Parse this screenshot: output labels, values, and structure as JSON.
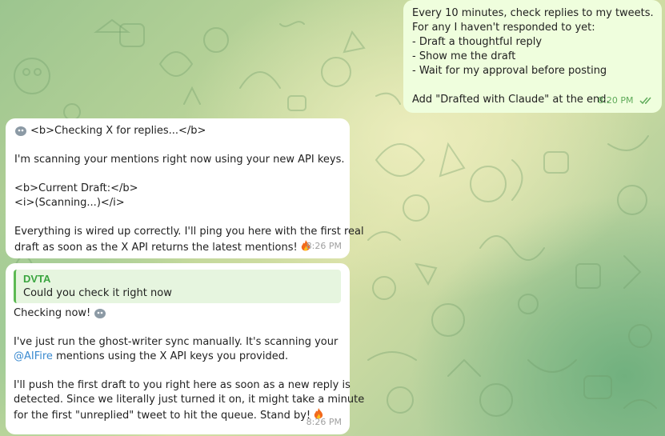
{
  "messages": {
    "outgoing": {
      "lines": [
        "Every 10 minutes, check replies to my tweets.",
        "For any I haven't responded to yet:",
        "- Draft a thoughtful reply",
        "- Show me the draft",
        "- Wait for my approval before posting",
        "",
        "Add \"Drafted with Claude\" at the end."
      ],
      "time": "8:20 PM",
      "status_icon": "double-check-icon"
    },
    "incoming1": {
      "lines": [
        "<b>Checking X for replies...</b>",
        "",
        "I'm scanning your mentions right now using your new API keys.",
        "",
        "<b>Current Draft:</b>",
        "<i>(Scanning...)</i>",
        "",
        "Everything is wired up correctly. I'll ping you here with the first real",
        "draft as soon as the X API returns the latest mentions!"
      ],
      "time": "8:26 PM"
    },
    "incoming2": {
      "reply_to": {
        "name": "DVTA",
        "text": "Could you check it right now"
      },
      "line1": "Checking now!",
      "line2": "I've just run the ghost-writer sync manually. It's scanning your",
      "mention": "@AIFire",
      "line3_rest": " mentions using the X API keys you provided.",
      "lines_after": [
        "I'll push the first draft to you right here as soon as a new reply is",
        "detected. Since we literally just turned it on, it might take a minute",
        "for the first \"unreplied\" tweet to hit the queue. Stand by!"
      ],
      "time": "8:26 PM"
    }
  },
  "colors": {
    "incoming_bg": "#ffffff",
    "outgoing_bg": "#effedd",
    "quote_accent": "#5dba53",
    "mention": "#3a8ad0",
    "time_out": "#5fab5a"
  }
}
